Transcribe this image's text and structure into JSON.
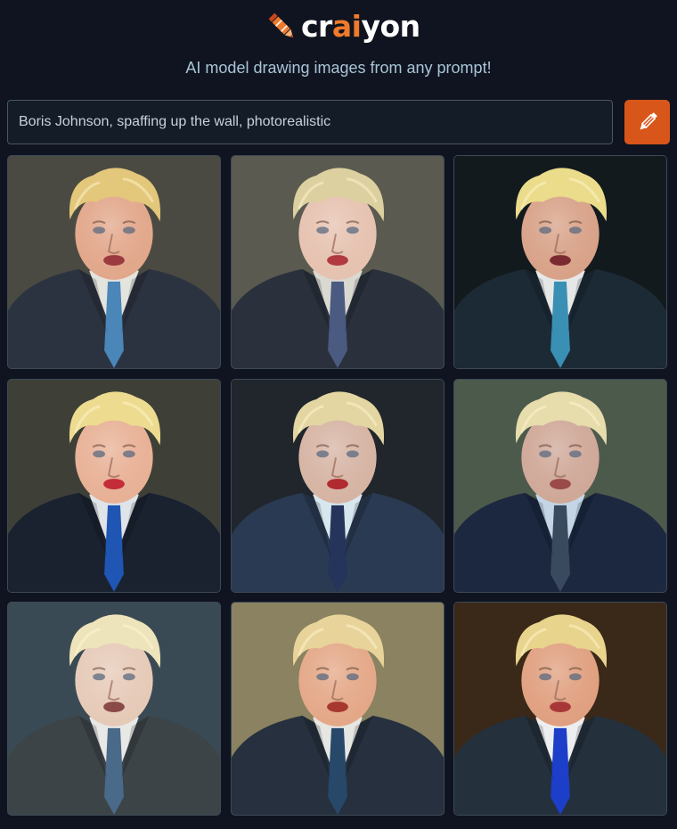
{
  "header": {
    "logo_prefix": "cr",
    "logo_accent": "ai",
    "logo_suffix": "yon",
    "tagline": "AI model drawing images from any prompt!"
  },
  "search": {
    "value": "Boris Johnson, spaffing up the wall, photorealistic",
    "button_icon": "pencil-icon"
  },
  "colors": {
    "background": "#0f1420",
    "brand_orange": "#f07a2c",
    "button_orange": "#d9561a",
    "tagline": "#a9c4d6"
  },
  "results": [
    {
      "bg": "#4b4a42",
      "suit": "#2c3340",
      "shirt": "#e4e4de",
      "tie": "#4a86b8",
      "hair": "#e3c77a",
      "skin": "#e2a78b",
      "lips": "#9b3a40"
    },
    {
      "bg": "#5a5a50",
      "suit": "#2a313c",
      "shirt": "#d9d9d2",
      "tie": "#4a5a80",
      "hair": "#ddd0a0",
      "skin": "#e6c2b0",
      "lips": "#b03a40"
    },
    {
      "bg": "#121a1e",
      "suit": "#1c2a36",
      "shirt": "#e6e8e8",
      "tie": "#3a8fb4",
      "hair": "#eadc8a",
      "skin": "#d8a288",
      "lips": "#7a2a30"
    },
    {
      "bg": "#3e4038",
      "suit": "#1a2230",
      "shirt": "#dfe4e8",
      "tie": "#1f56b4",
      "hair": "#eddc90",
      "skin": "#e8b196",
      "lips": "#c42c38"
    },
    {
      "bg": "#20262c",
      "suit": "#2a3a52",
      "shirt": "#d8e6ee",
      "tie": "#24345a",
      "hair": "#e4d6a2",
      "skin": "#d6b4a4",
      "lips": "#b02a30"
    },
    {
      "bg": "#4c5a4c",
      "suit": "#1c2840",
      "shirt": "#c4d6e6",
      "tie": "#3a4a5e",
      "hair": "#e6dcac",
      "skin": "#cfa898",
      "lips": "#9a4a48"
    },
    {
      "bg": "#3a4a54",
      "suit": "#3c4448",
      "shirt": "#e8e8e6",
      "tie": "#4a6a8a",
      "hair": "#eee4bc",
      "skin": "#e6cab8",
      "lips": "#8a4a48"
    },
    {
      "bg": "#8a8260",
      "suit": "#26303e",
      "shirt": "#e6e6e2",
      "tie": "#28486a",
      "hair": "#e8d49a",
      "skin": "#e4a888",
      "lips": "#a63830"
    },
    {
      "bg": "#3a2818",
      "suit": "#24303c",
      "shirt": "#eceef0",
      "tie": "#1c3ec8",
      "hair": "#e8d48c",
      "skin": "#e0a080",
      "lips": "#a83838"
    }
  ]
}
